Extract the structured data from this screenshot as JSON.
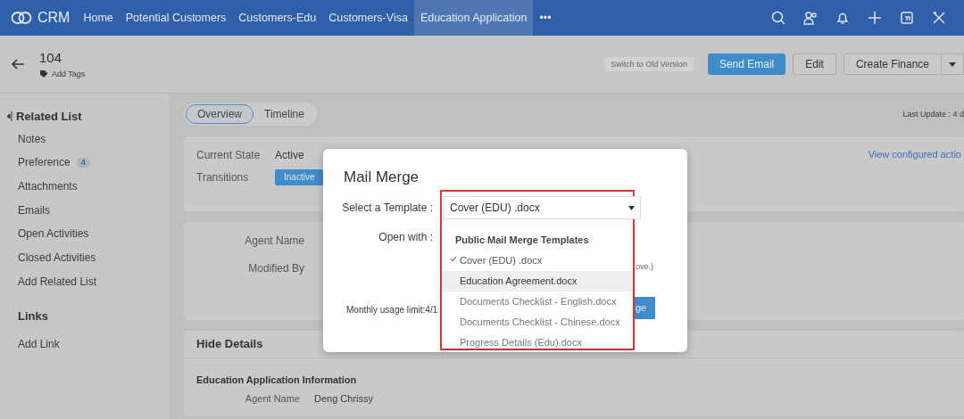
{
  "navbar": {
    "logo": "CRM",
    "more": "•••",
    "tabs": [
      {
        "label": "Home",
        "selected": false
      },
      {
        "label": "Potential Customers",
        "selected": false
      },
      {
        "label": "Customers-Edu",
        "selected": false
      },
      {
        "label": "Customers-Visa",
        "selected": false
      },
      {
        "label": "Education Application",
        "selected": true
      }
    ]
  },
  "record": {
    "title": "104",
    "add_tags": "Add Tags"
  },
  "actions": {
    "switch": "Switch to Old Version",
    "buttons": [
      {
        "label": "Send Email",
        "kind": "primary"
      },
      {
        "label": "Edit",
        "kind": "default"
      },
      {
        "label": "Create Finance",
        "kind": "split"
      }
    ]
  },
  "sidebar": {
    "heading": "Related List",
    "items": [
      {
        "label": "Notes",
        "kind": "item"
      },
      {
        "label": "Preference",
        "kind": "item",
        "count": "4"
      },
      {
        "label": "Attachments",
        "kind": "item"
      },
      {
        "label": "Emails",
        "kind": "item"
      },
      {
        "label": "Open Activities",
        "kind": "item"
      },
      {
        "label": "Closed Activities",
        "kind": "item"
      },
      {
        "label": "Add Related List",
        "kind": "link"
      }
    ],
    "links_heading": "Links",
    "links": [
      {
        "label": "Add Link"
      }
    ]
  },
  "view_tabs": [
    {
      "label": "Overview",
      "selected": true
    },
    {
      "label": "Timeline",
      "selected": false
    }
  ],
  "last_update": "Last Update : 4 d",
  "state_card": {
    "current_state_label": "Current State",
    "current_state": "Active",
    "transitions_label": "Transitions",
    "transition_button": "Inactive",
    "configured_link": "View configured actio"
  },
  "summary_card": {
    "fields": [
      {
        "label": "Agent Name"
      },
      {
        "label": "Modified By"
      }
    ]
  },
  "details": {
    "toggle": "Hide Details",
    "section": "Education Application Information",
    "fields": [
      {
        "label": "Agent Name",
        "value": "Deng Chrissy"
      }
    ]
  },
  "modal": {
    "title": "Mail Merge",
    "template_label": "Select a Template :",
    "template_value": "Cover (EDU) .docx",
    "open_with_label": "Open with :",
    "note_fragment": "ove.)",
    "usage": "Monthly usage limit:4/1",
    "button_fragment": "ge",
    "dropdown": {
      "highlighted": true,
      "group": "Public Mail Merge Templates",
      "options": [
        {
          "label": "Cover (EDU) .docx",
          "selected": true,
          "hovered": false
        },
        {
          "label": "Education Agreement.docx",
          "selected": false,
          "hovered": true
        },
        {
          "label": "Documents Checklist - English.docx",
          "selected": false,
          "hovered": false
        },
        {
          "label": "Documents Checklist - Chinese.docx",
          "selected": false,
          "hovered": false
        },
        {
          "label": "Progress Details (Edu).docx",
          "selected": false,
          "hovered": false
        }
      ]
    }
  }
}
